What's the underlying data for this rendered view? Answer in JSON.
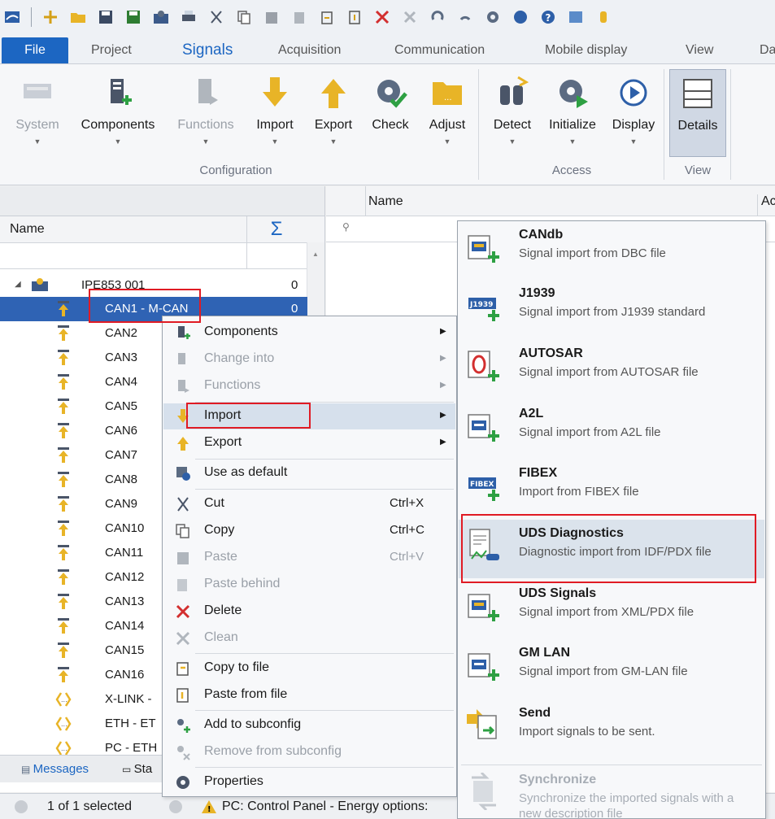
{
  "ribbon_tabs": [
    "File",
    "Project",
    "Signals",
    "Acquisition",
    "Communication",
    "Mobile display",
    "View",
    "Da"
  ],
  "active_tab": "Signals",
  "ribbon_buttons": {
    "system": "System",
    "components": "Components",
    "functions": "Functions",
    "import": "Import",
    "export": "Export",
    "check": "Check",
    "adjust": "Adjust",
    "detect": "Detect",
    "initialize": "Initialize",
    "display": "Display",
    "details": "Details"
  },
  "ribbon_groups": {
    "configuration": "Configuration",
    "access": "Access",
    "view": "View"
  },
  "tree": {
    "col_name": "Name",
    "col_sum": "Σ",
    "root": {
      "name": "IPE853 001",
      "count": "0"
    },
    "selected": {
      "name": "CAN1 - M-CAN",
      "count": "0"
    },
    "items": [
      "CAN2",
      "CAN3",
      "CAN4",
      "CAN5",
      "CAN6",
      "CAN7",
      "CAN8",
      "CAN9",
      "CAN10",
      "CAN11",
      "CAN12",
      "CAN13",
      "CAN14",
      "CAN15",
      "CAN16",
      "X-LINK -",
      "ETH - ET",
      "PC - ETH"
    ]
  },
  "grid": {
    "col_name": "Name",
    "col_ac": "Ac"
  },
  "bottom_tabs": {
    "messages": "Messages",
    "status": "Sta"
  },
  "status": {
    "selection": "1 of 1 selected",
    "warning": "PC: Control Panel - Energy options:"
  },
  "context_menu": {
    "components": "Components",
    "change_into": "Change into",
    "functions": "Functions",
    "import": "Import",
    "export": "Export",
    "use_as_default": "Use as default",
    "cut": "Cut",
    "cut_shortcut": "Ctrl+X",
    "copy": "Copy",
    "copy_shortcut": "Ctrl+C",
    "paste": "Paste",
    "paste_shortcut": "Ctrl+V",
    "paste_behind": "Paste behind",
    "delete": "Delete",
    "clean": "Clean",
    "copy_to_file": "Copy to file",
    "paste_from_file": "Paste from file",
    "add_to_subconfig": "Add to subconfig",
    "remove_from_subconfig": "Remove from subconfig",
    "properties": "Properties"
  },
  "import_submenu": [
    {
      "title": "CANdb",
      "desc": "Signal import from DBC file"
    },
    {
      "title": "J1939",
      "desc": "Signal import from J1939 standard"
    },
    {
      "title": "AUTOSAR",
      "desc": "Signal import from AUTOSAR file"
    },
    {
      "title": "A2L",
      "desc": "Signal import from A2L file"
    },
    {
      "title": "FIBEX",
      "desc": "Import from FIBEX file"
    },
    {
      "title": "UDS Diagnostics",
      "desc": "Diagnostic import from IDF/PDX file"
    },
    {
      "title": "UDS Signals",
      "desc": "Signal import from XML/PDX file"
    },
    {
      "title": "GM LAN",
      "desc": "Signal import from GM-LAN file"
    },
    {
      "title": "Send",
      "desc": "Import signals to be sent."
    },
    {
      "title": "Synchronize",
      "desc": "Synchronize the imported signals with a new description file"
    }
  ],
  "icon_badges": {
    "j1939": "J1939",
    "fibex": "FIBEX"
  }
}
